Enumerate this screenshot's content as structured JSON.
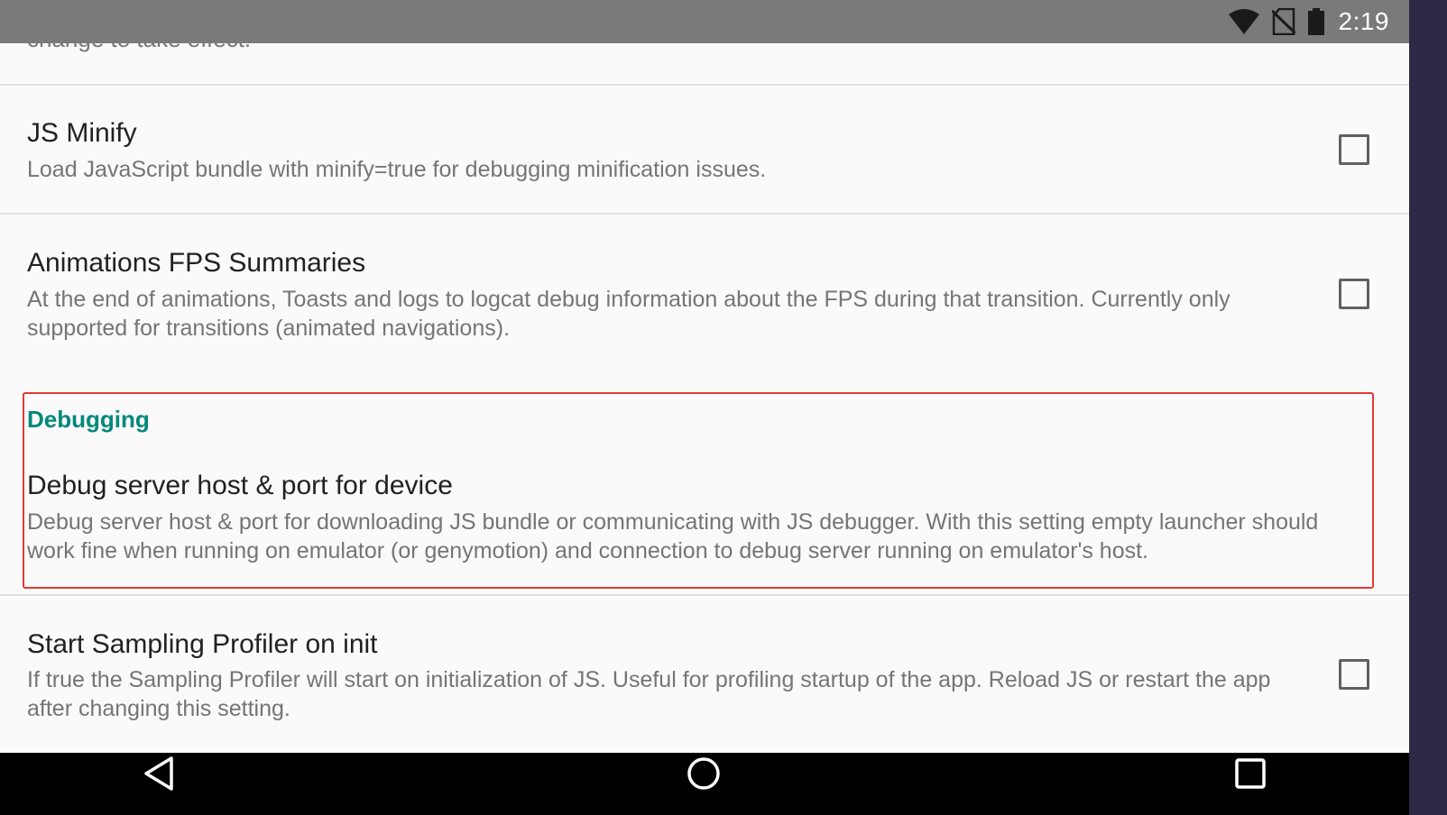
{
  "status_bar": {
    "time": "2:19",
    "icons": [
      "wifi-icon",
      "no-sim-icon",
      "battery-icon"
    ]
  },
  "prev_item_fragment": "change to take effect.",
  "prefs": [
    {
      "title": "JS Minify",
      "summary": "Load JavaScript bundle with minify=true for debugging minification issues.",
      "checked": false
    },
    {
      "title": "Animations FPS Summaries",
      "summary": "At the end of animations, Toasts and logs to logcat debug information about the FPS during that transition. Currently only supported for transitions (animated navigations).",
      "checked": false
    }
  ],
  "debugging": {
    "category": "Debugging",
    "title": "Debug server host & port for device",
    "summary": "Debug server host & port for downloading JS bundle or communicating with JS debugger. With this setting empty launcher should work fine when running on emulator (or genymotion) and connection to debug server running on emulator's host."
  },
  "sampling": {
    "title": "Start Sampling Profiler on init",
    "summary": "If true the Sampling Profiler will start on initialization of JS. Useful for profiling startup of the app. Reload JS or restart the app after changing this setting.",
    "checked": false
  },
  "nav_bar": {
    "icons": [
      "back-icon",
      "home-icon",
      "recents-icon"
    ]
  },
  "colors": {
    "accent": "#00897b",
    "highlight": "#e53935",
    "status_bar": "#7a7a7a"
  }
}
